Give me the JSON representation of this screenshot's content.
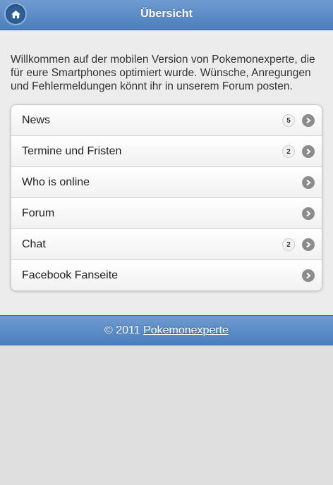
{
  "header": {
    "title": "Übersicht",
    "home_icon": "home-icon",
    "accent_color": "#4a7fbd"
  },
  "intro": {
    "text": "Willkommen auf der mobilen Version von Pokemonexperte, die für eure Smartphones optimiert wurde. Wünsche, Anregungen und Fehlermeldungen könnt ihr in unserem Forum posten."
  },
  "menu": {
    "items": [
      {
        "label": "News",
        "count": "5"
      },
      {
        "label": "Termine und Fristen",
        "count": "2"
      },
      {
        "label": "Who is online",
        "count": ""
      },
      {
        "label": "Forum",
        "count": ""
      },
      {
        "label": "Chat",
        "count": "2"
      },
      {
        "label": "Facebook Fanseite",
        "count": ""
      }
    ],
    "arrow_icon": "chevron-right-icon"
  },
  "footer": {
    "copyright": "© 2011",
    "link_text": "Pokemonexperte"
  }
}
